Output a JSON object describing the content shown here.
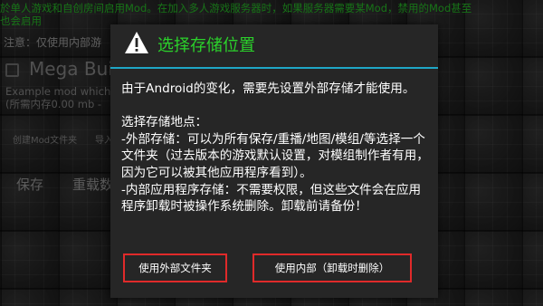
{
  "background": {
    "notice_line1": "於单人游戏和自创房间启用Mod。在加入多人游戏服务器时，如果服务器需要某Mod，禁用的Mod甚至",
    "notice_line2": "也会启用",
    "note": "注意：仅使用内部游",
    "mod_title": "Mega Buil",
    "mod_desc_line1": "Example mod which",
    "mod_desc_line2": "(所需内存0.00 mb -",
    "create_mod_folder_label": "创建Mod文件夹",
    "import_label": "导入",
    "save_label": "保存",
    "reload_label": "重载数"
  },
  "dialog": {
    "icon": "warning-icon",
    "title": "选择存储位置",
    "body": "由于Android的变化，需要先设置外部存储才能使用。\n\n选择存储地点：\n-外部存储：可以为所有保存/重播/地图/模组/等选择一个文件夹（过去版本的游戏默认设置，对模组制作者有用，因为它可以被其他应用程序看到）。\n-内部应用程序存储：不需要权限，但这些文件会在应用程序卸载时被操作系统删除。卸载前请备份！",
    "btn_external": "使用外部文件夹",
    "btn_internal": "使用内部（卸载时删除）"
  },
  "colors": {
    "accent_green": "#2bd12b",
    "separator_blue": "#1fa6c6",
    "button_border_red": "#e02a2a"
  }
}
